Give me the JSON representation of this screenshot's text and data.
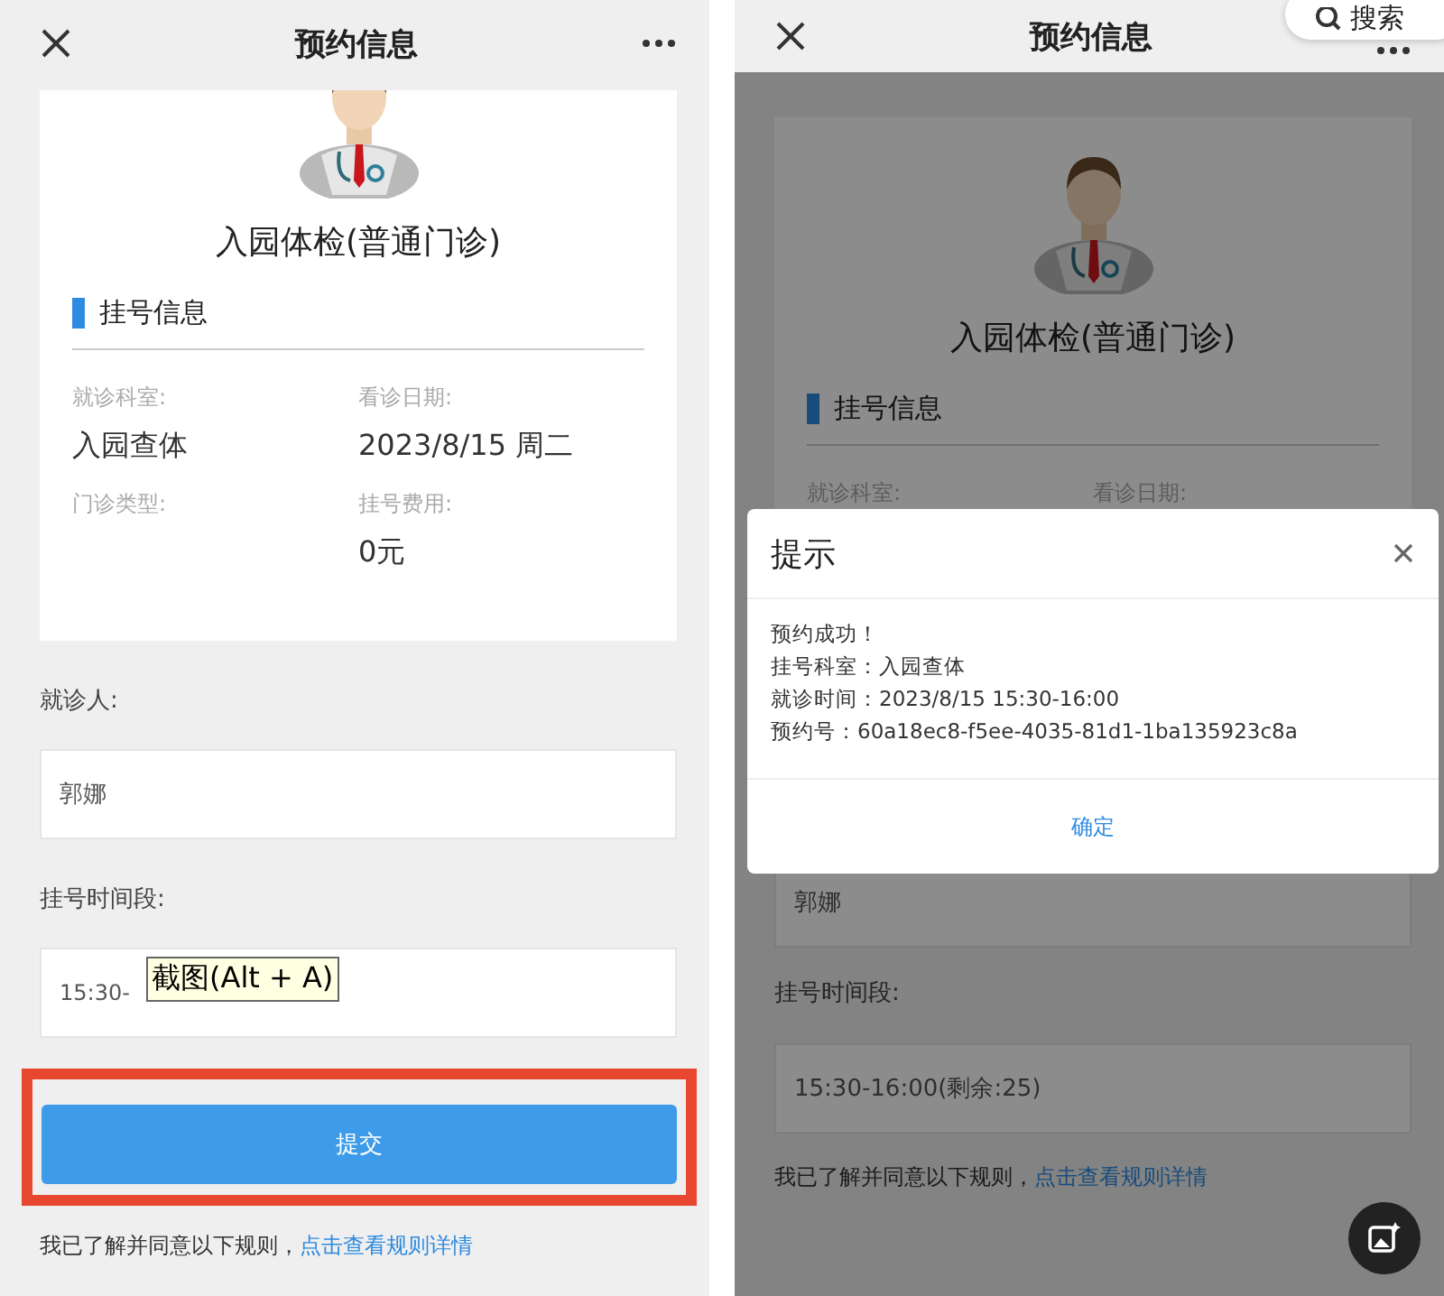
{
  "screens": [
    {
      "header_title": "预约信息",
      "doctor_title": "入园体检(普通门诊)",
      "section_title": "挂号信息",
      "info_fields": [
        {
          "label": "就诊科室:",
          "value": "入园查体"
        },
        {
          "label": "看诊日期:",
          "value": "2023/8/15 周二"
        },
        {
          "label": "门诊类型:"
        },
        {
          "label": "挂号费用:",
          "value": "0元"
        }
      ],
      "patient": {
        "label": "就诊人:",
        "value": "郭娜"
      },
      "time_slot": {
        "label": "挂号时间段:",
        "value": "15:30-"
      },
      "tooltip": "截图(Alt + A)",
      "submit_button": {
        "label": "提交",
        "highlighted": true
      },
      "agreement": {
        "text": "我已了解并同意以下规则，",
        "link": "点击查看规则详情"
      }
    },
    {
      "header_title": "预约信息",
      "search_popup": {
        "label": "搜索"
      },
      "doctor_title": "入园体检(普通门诊)",
      "section_title": "挂号信息",
      "info_fields": [
        {
          "label": "就诊科室:"
        },
        {
          "label": "看诊日期:"
        }
      ],
      "patient": {
        "value": "郭娜"
      },
      "time_slot": {
        "label": "挂号时间段:",
        "value": "15:30-16:00(剩余:25)"
      },
      "agreement": {
        "text": "我已了解并同意以下规则，",
        "link": "点击查看规则详情"
      },
      "dialog": {
        "title": "提示",
        "lines": [
          "预约成功！",
          "挂号科室：入园查体",
          "就诊时间：2023/8/15 15:30-16:00",
          "预约号：60a18ec8-f5ee-4035-81d1-1ba135923c8a"
        ],
        "confirm": "确定"
      },
      "floating_button": true
    }
  ]
}
